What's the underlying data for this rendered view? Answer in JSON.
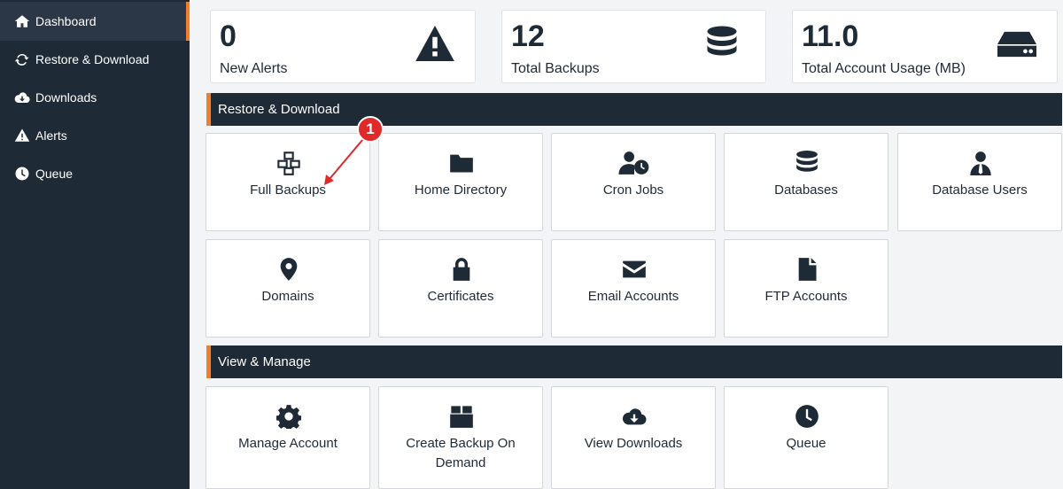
{
  "sidebar": {
    "items": [
      {
        "label": "Dashboard",
        "icon": "home-icon"
      },
      {
        "label": "Restore & Download",
        "icon": "refresh-icon"
      },
      {
        "label": "Downloads",
        "icon": "cloud-download-icon"
      },
      {
        "label": "Alerts",
        "icon": "warning-icon"
      },
      {
        "label": "Queue",
        "icon": "clock-icon"
      }
    ]
  },
  "stats": [
    {
      "value": "0",
      "label": "New Alerts",
      "icon": "warning-icon"
    },
    {
      "value": "12",
      "label": "Total Backups",
      "icon": "database-icon"
    },
    {
      "value": "11.0",
      "label": "Total Account Usage (MB)",
      "icon": "hdd-icon"
    }
  ],
  "sections": {
    "restore": {
      "title": "Restore & Download",
      "tiles": [
        {
          "label": "Full Backups",
          "icon": "cubes-icon"
        },
        {
          "label": "Home Directory",
          "icon": "folder-icon"
        },
        {
          "label": "Cron Jobs",
          "icon": "user-clock-icon"
        },
        {
          "label": "Databases",
          "icon": "database-icon"
        },
        {
          "label": "Database Users",
          "icon": "user-tie-icon"
        },
        {
          "label": "Domains",
          "icon": "map-marker-icon"
        },
        {
          "label": "Certificates",
          "icon": "lock-icon"
        },
        {
          "label": "Email Accounts",
          "icon": "envelope-icon"
        },
        {
          "label": "FTP Accounts",
          "icon": "file-icon"
        }
      ]
    },
    "manage": {
      "title": "View & Manage",
      "tiles": [
        {
          "label": "Manage Account",
          "icon": "gear-icon"
        },
        {
          "label": "Create Backup On Demand",
          "icon": "box-icon"
        },
        {
          "label": "View Downloads",
          "icon": "cloud-download-icon"
        },
        {
          "label": "Queue",
          "icon": "clock-icon"
        }
      ]
    }
  },
  "annotation": {
    "badge": "1"
  },
  "colors": {
    "sidebar": "#1f2a37",
    "accent": "#f07e2a",
    "annotation": "#e02a2a"
  }
}
